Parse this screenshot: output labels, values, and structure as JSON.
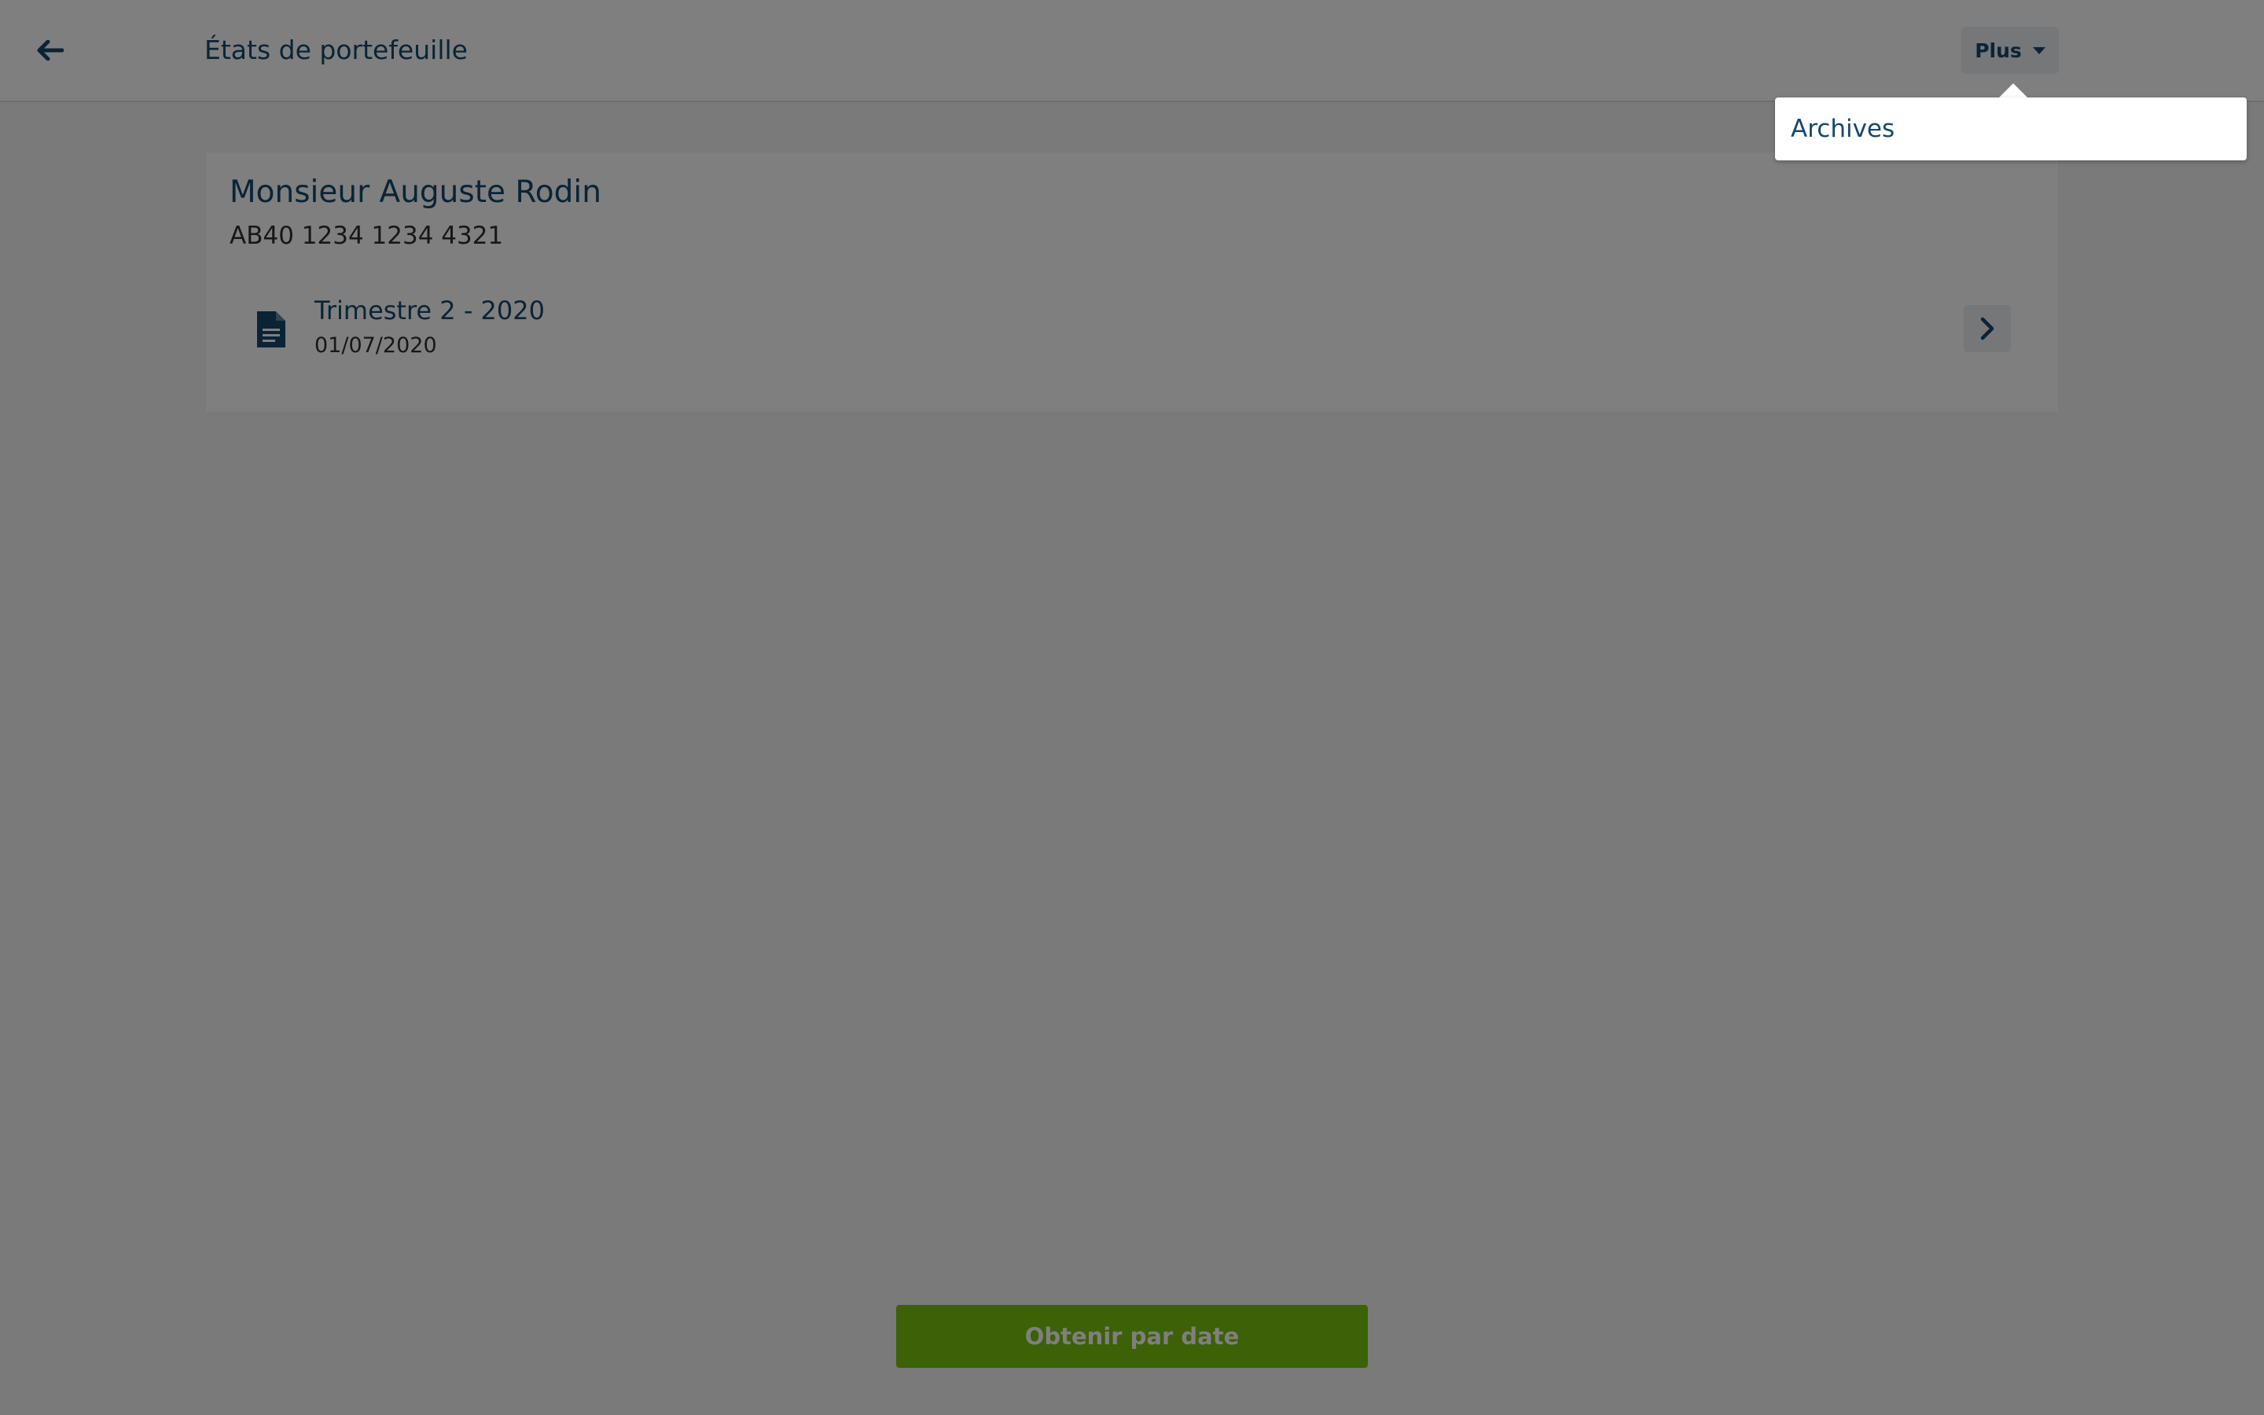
{
  "header": {
    "title": "États de portefeuille",
    "back_icon": "arrow-left-icon",
    "more_button": {
      "label": "Plus",
      "icon": "caret-down-icon"
    }
  },
  "dropdown": {
    "items": [
      {
        "label": "Archives"
      }
    ]
  },
  "account": {
    "holder_name": "Monsieur Auguste Rodin",
    "number": "AB40 1234 1234 4321",
    "statements": [
      {
        "title": "Trimestre 2 - 2020",
        "date": "01/07/2020",
        "icon": "document-icon",
        "action_icon": "chevron-right-icon"
      }
    ]
  },
  "footer": {
    "primary_button_label": "Obtenir par date"
  },
  "colors": {
    "primary_text": "#15486b",
    "accent_green": "#78c30d",
    "overlay": "rgba(0,0,0,0.5)",
    "button_secondary_bg": "#ebeef0"
  }
}
